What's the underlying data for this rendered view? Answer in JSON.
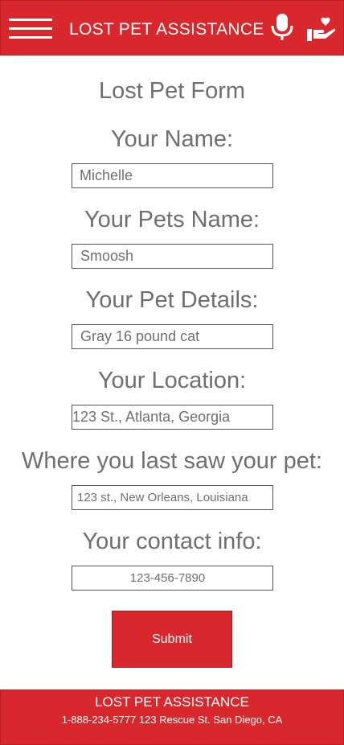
{
  "header": {
    "title": "LOST PET ASSISTANCE",
    "menu_icon": "hamburger-menu-icon",
    "mic_icon": "microphone-icon",
    "care_icon": "hand-heart-icon"
  },
  "form": {
    "title": "Lost Pet Form",
    "fields": [
      {
        "label": "Your Name:",
        "value": "Michelle"
      },
      {
        "label": "Your Pets Name:",
        "value": "Smoosh"
      },
      {
        "label": "Your Pet Details:",
        "value": "Gray 16 pound cat"
      },
      {
        "label": "Your Location:",
        "value": "123 St., Atlanta, Georgia"
      },
      {
        "label": "Where you last saw your pet:",
        "value": "123 st., New Orleans, Louisiana"
      },
      {
        "label": "Your contact info:",
        "value": "123-456-7890"
      }
    ],
    "submit_label": "Submit"
  },
  "footer": {
    "title": "LOST PET ASSISTANCE",
    "contact": "1-888-234-5777 123 Rescue St.  San Diego, CA"
  },
  "colors": {
    "brand_red": "#d9282d",
    "text_gray": "#6f6f6f"
  }
}
